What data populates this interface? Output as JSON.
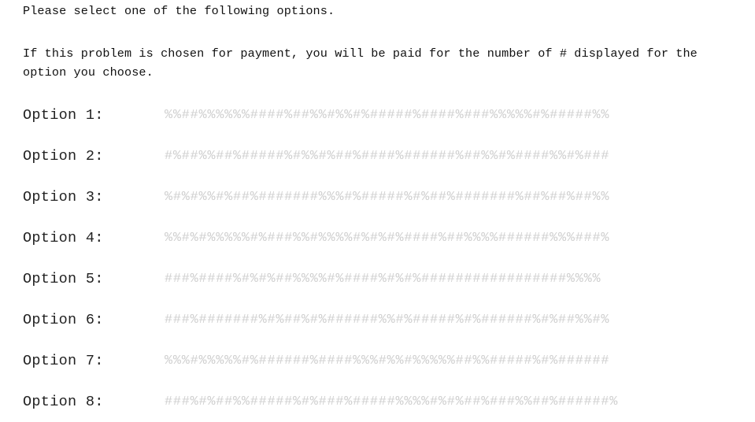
{
  "instructions": {
    "line1": "Please select one of the following options.",
    "line2": "If this problem is chosen for payment, you will be paid for the number of # displayed for the option you choose."
  },
  "options": [
    {
      "label": "Option 1:",
      "pattern": "%%##%%%%%%####%##%%#%%#%#####%####%###%%%%%#%#####%%"
    },
    {
      "label": "Option 2:",
      "pattern": "#%##%%##%#####%#%%#%##%####%######%##%%#%####%%#%###"
    },
    {
      "label": "Option 3:",
      "pattern": "%#%#%%#%##%#######%%%#%#####%#%##%#######%##%##%##%%"
    },
    {
      "label": "Option 4:",
      "pattern": "%%#%#%%%%%#%###%%#%%%%#%#%#%####%##%%%%######%%%###%"
    },
    {
      "label": "Option 5:",
      "pattern": "###%####%#%#%##%%%%#%####%#%#%#################%%%%"
    },
    {
      "label": "Option 6:",
      "pattern": "###%#######%#%##%#%######%%#%#####%#%######%#%##%%#%"
    },
    {
      "label": "Option 7:",
      "pattern": "%%%#%%%%%#%######%####%%%#%%#%%%%%##%%#####%#%######"
    },
    {
      "label": "Option 8:",
      "pattern": "###%#%##%%#####%#%###%#####%%%%#%#%##%###%%##%######%"
    }
  ]
}
